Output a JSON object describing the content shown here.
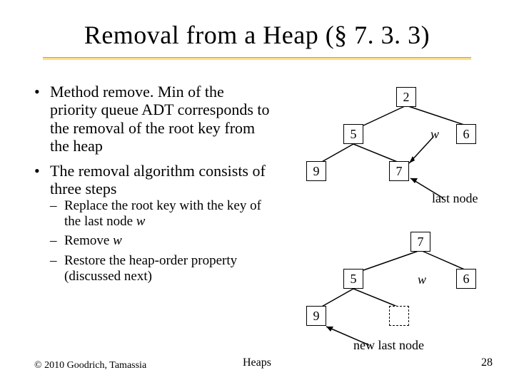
{
  "title": "Removal from a Heap (§ 7. 3. 3)",
  "bullet1": "Method remove. Min of the priority queue ADT corresponds to the removal of the root key from the heap",
  "bullet2": "The removal algorithm consists of three steps",
  "sub1_a": "Replace the root key with the key of the last node ",
  "sub1_w": "w",
  "sub2_a": "Remove ",
  "sub2_w": "w",
  "sub3": "Restore the heap-order property (discussed next)",
  "copyright": "© 2010 Goodrich, Tamassia",
  "footer": "Heaps",
  "pagenum": "28",
  "tree1": {
    "root": "2",
    "leftChild": "5",
    "rightChild": "6",
    "leftLeft": "9",
    "leftRight": "7",
    "wLabel": "w",
    "lastNodeLabel": "last node"
  },
  "tree2": {
    "root": "7",
    "leftChild": "5",
    "rightChild": "6",
    "leftLeft": "9",
    "wLabel": "w",
    "newLastNodeLabel": "new last node"
  }
}
